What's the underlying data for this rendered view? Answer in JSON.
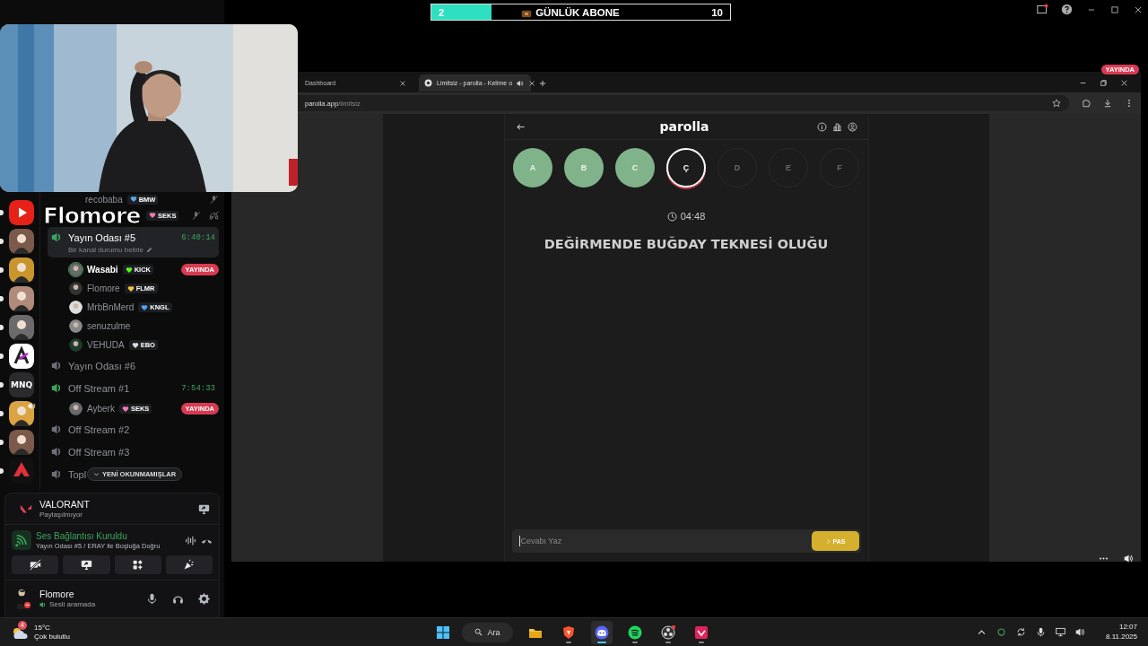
{
  "goal": {
    "current": "2",
    "label": "GÜNLÜK ABONE",
    "target": "10",
    "level": 0.2
  },
  "streamer_name": "Flomore",
  "discord": {
    "servers": [
      {
        "kind": "youtube",
        "unread": true,
        "audio": false
      },
      {
        "kind": "avatar",
        "unread": true,
        "audio": false
      },
      {
        "kind": "avatar",
        "unread": true,
        "audio": false
      },
      {
        "kind": "avatar",
        "unread": true,
        "audio": false
      },
      {
        "kind": "avatar",
        "unread": true,
        "audio": false
      },
      {
        "kind": "logo",
        "unread": true,
        "audio": false
      },
      {
        "kind": "text",
        "label": "MNQ",
        "unread": true,
        "audio": false
      },
      {
        "kind": "avatar",
        "unread": true,
        "audio": true
      },
      {
        "kind": "avatar",
        "unread": true,
        "audio": false
      },
      {
        "kind": "logo",
        "unread": true,
        "audio": false
      }
    ],
    "partial_members": [
      {
        "name": "recobaba",
        "tag": {
          "text": "BMW",
          "color": "#5aa9e6"
        },
        "muted": true,
        "deafened": false
      },
      {
        "tag": {
          "text": "SEKS",
          "color": "#f27ab0"
        },
        "muted": true,
        "deafened": true
      }
    ],
    "channels": [
      {
        "name": "Yayın Odası #5",
        "active": true,
        "selected": true,
        "timer": "6:40:14",
        "status": "Bir kanal durumu belirle",
        "members": [
          {
            "name": "Wasabi",
            "speaking": true,
            "tag": {
              "text": "KICK",
              "color": "#53fc18"
            },
            "live": "YAYINDA"
          },
          {
            "name": "Flomore",
            "speaking": false,
            "tag": {
              "text": "FLMR",
              "color": "#f5c542"
            }
          },
          {
            "name": "MrbBnMerd",
            "speaking": false,
            "tag": {
              "text": "KNGL",
              "color": "#4aa3ff"
            }
          },
          {
            "name": "senuzulme",
            "speaking": false
          },
          {
            "name": "VEHUDA",
            "speaking": false,
            "tag": {
              "text": "EBO",
              "color": "#dddddd"
            }
          }
        ]
      },
      {
        "name": "Yayın Odası #6",
        "active": false,
        "selected": false
      },
      {
        "name": "Off Stream #1",
        "active": true,
        "selected": false,
        "timer": "7:54:33",
        "members": [
          {
            "name": "Ayberk",
            "speaking": false,
            "tag": {
              "text": "SEKS",
              "color": "#f27ab0"
            },
            "live": "YAYINDA"
          }
        ]
      },
      {
        "name": "Off Stream #2",
        "active": false,
        "selected": false
      },
      {
        "name": "Off Stream #3",
        "active": false,
        "selected": false
      },
      {
        "name": "Topl",
        "active": false,
        "selected": false
      }
    ],
    "unread_pill": "YENİ OKUNMAMIŞLAR",
    "activity": {
      "title": "VALORANT",
      "subtitle": "Paylaşılmıyor"
    },
    "voice": {
      "status": "Ses Bağlantısı Kuruldu",
      "channel": "Yayın Odası #5 / ERAY ile Boşluğa Doğru"
    },
    "user": {
      "name": "Flomore",
      "status": "Sesli aramada"
    }
  },
  "browser": {
    "live_badge": "YAYINDA",
    "tabs": [
      {
        "title": "Dashboard",
        "selected": false,
        "audio": false
      },
      {
        "title": "Limitsiz - parolla - Kelime o",
        "selected": true,
        "audio": true
      }
    ],
    "url": {
      "host": "parolla.app",
      "path": "/limitsiz"
    }
  },
  "app": {
    "title": "parolla",
    "letters": [
      {
        "letter": "A",
        "kind": "correct"
      },
      {
        "letter": "B",
        "kind": "correct"
      },
      {
        "letter": "C",
        "kind": "correct"
      },
      {
        "letter": "Ç",
        "kind": "current"
      },
      {
        "letter": "D",
        "kind": "pending"
      },
      {
        "letter": "E",
        "kind": "pending"
      },
      {
        "letter": "F",
        "kind": "pending"
      }
    ],
    "timer": "04:48",
    "question": "DEĞİRMENDE BUĞDAY TEKNESİ OLUĞU",
    "answer": {
      "placeholder": "Cevabı Yaz"
    },
    "pass_button": "PAS"
  },
  "taskbar": {
    "weather": {
      "badge": "4",
      "temp": "15°C",
      "desc": "Çok bulutlu"
    },
    "search": "Ara",
    "apps": [
      {
        "kind": "explorer",
        "running": false,
        "selected": false
      },
      {
        "kind": "brave",
        "running": true,
        "selected": false
      },
      {
        "kind": "discord",
        "running": true,
        "selected": true
      },
      {
        "kind": "spotify",
        "running": true,
        "selected": false
      },
      {
        "kind": "obs",
        "running": true,
        "selected": false
      },
      {
        "kind": "red",
        "running": true,
        "selected": false
      }
    ],
    "time": "12:07",
    "date": "8.11.2025"
  }
}
